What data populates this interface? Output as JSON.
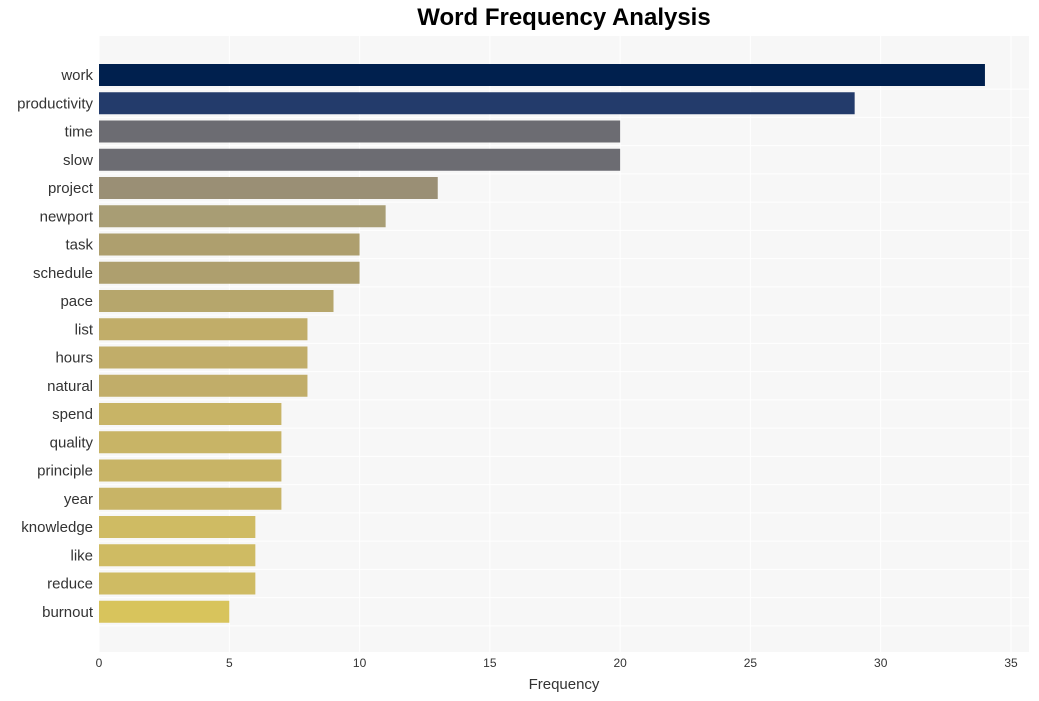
{
  "chart_data": {
    "type": "bar",
    "orientation": "horizontal",
    "title": "Word Frequency Analysis",
    "xlabel": "Frequency",
    "ylabel": "",
    "xlim": [
      0,
      35.7
    ],
    "xticks": [
      0,
      5,
      10,
      15,
      20,
      25,
      30,
      35
    ],
    "grid": true,
    "categories": [
      "work",
      "productivity",
      "time",
      "slow",
      "project",
      "newport",
      "task",
      "schedule",
      "pace",
      "list",
      "hours",
      "natural",
      "spend",
      "quality",
      "principle",
      "year",
      "knowledge",
      "like",
      "reduce",
      "burnout"
    ],
    "values": [
      34,
      29,
      20,
      20,
      13,
      11,
      10,
      10,
      9,
      8,
      8,
      8,
      7,
      7,
      7,
      7,
      6,
      6,
      6,
      5
    ],
    "colors": [
      "#00204e",
      "#233b6b",
      "#6c6c72",
      "#6c6c72",
      "#9a8f75",
      "#a89d74",
      "#ae9f6e",
      "#ae9f6e",
      "#b6a66c",
      "#c1ad69",
      "#c1ad69",
      "#c1ad69",
      "#c8b466",
      "#c8b466",
      "#c8b466",
      "#c8b466",
      "#cfbb63",
      "#cfbb63",
      "#cfbb63",
      "#d8c45c"
    ]
  }
}
